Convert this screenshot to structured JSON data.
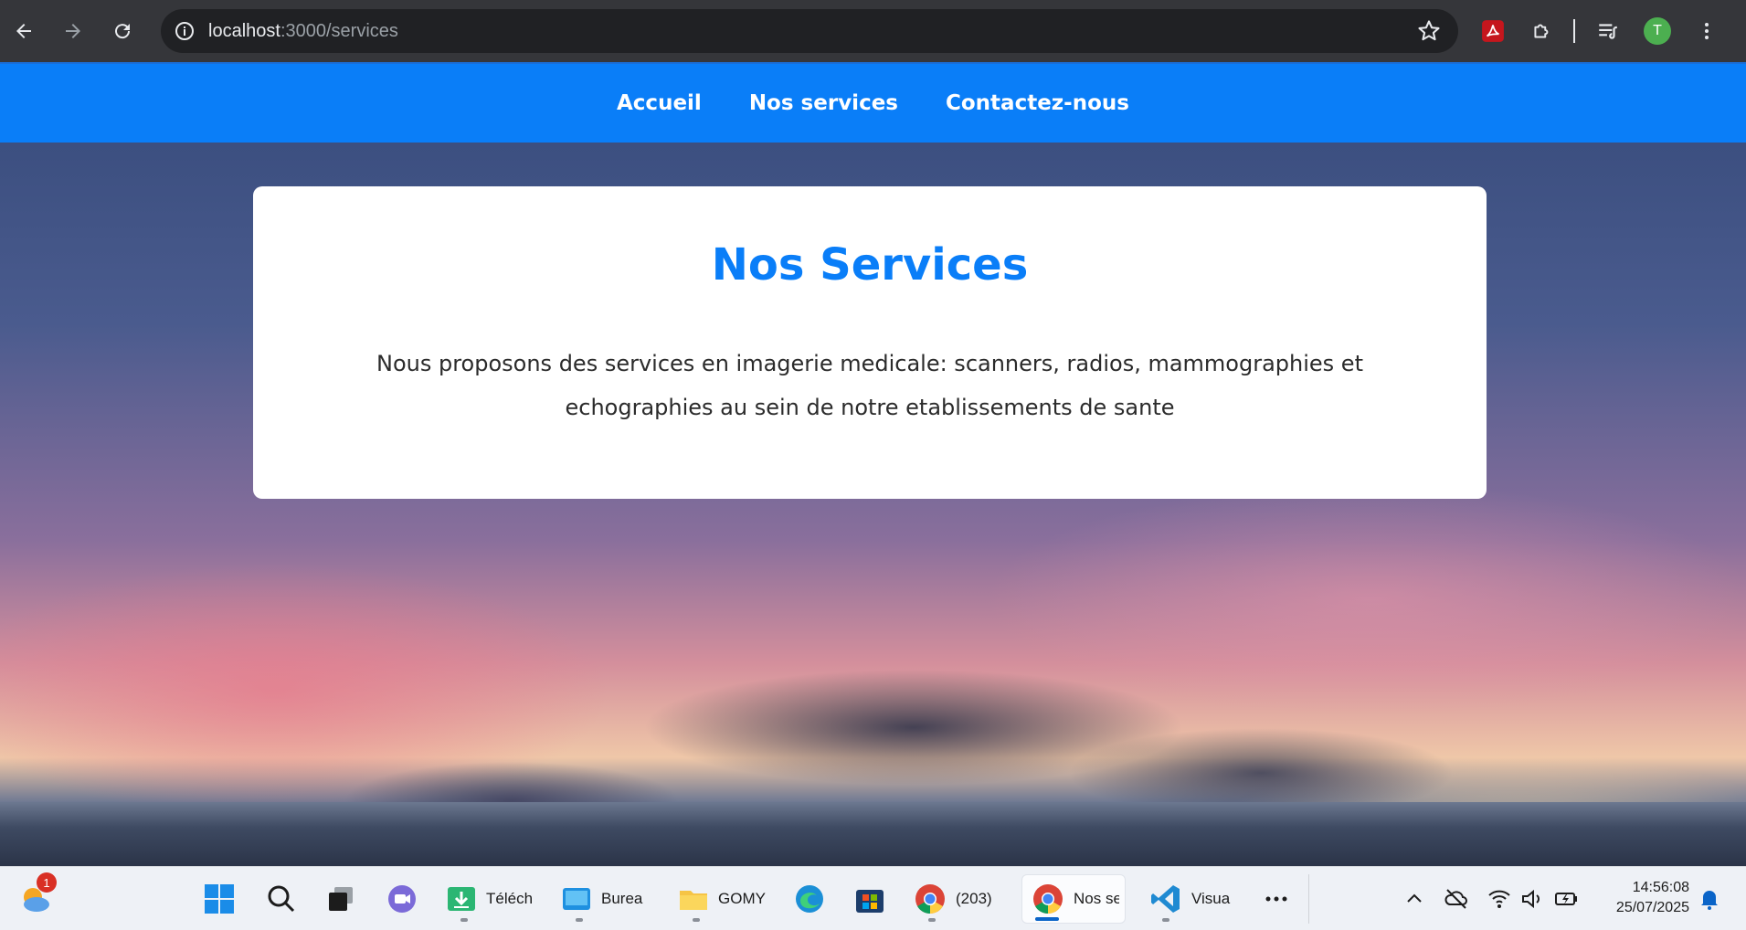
{
  "browser": {
    "url_host": "localhost",
    "url_path": ":3000/services",
    "profile_initial": "T"
  },
  "nav": {
    "items": [
      "Accueil",
      "Nos services",
      "Contactez-nous"
    ]
  },
  "card": {
    "title": "Nos Services",
    "text": "Nous proposons des services en imagerie medicale: scanners, radios, mammographies et echographies au sein de notre etablissements de sante"
  },
  "taskbar": {
    "weather_badge": "1",
    "apps": [
      {
        "label": "Téléch"
      },
      {
        "label": "Burea"
      },
      {
        "label": "GOMY"
      },
      {
        "label": "(203) "
      },
      {
        "label": "Nos se"
      },
      {
        "label": "Visua"
      }
    ],
    "time": "14:56:08",
    "date": "25/07/2025"
  },
  "colors": {
    "brand": "#0a7ef8",
    "chrome": "#35363a"
  }
}
